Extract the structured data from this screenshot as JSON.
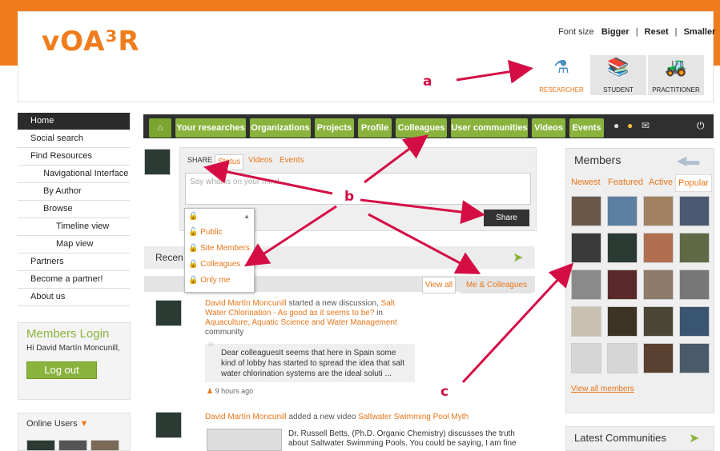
{
  "header": {
    "logo_text": "vOA³R",
    "font_size_label": "Font size",
    "font_bigger": "Bigger",
    "font_reset": "Reset",
    "font_smaller": "Smaller",
    "roles": [
      "RESEARCHER",
      "STUDENT",
      "PRACTITIONER"
    ]
  },
  "leftnav": {
    "items": [
      "Home",
      "Social search",
      "Find Resources",
      "Navigational Interface",
      "By Author",
      "Browse",
      "Timeline view",
      "Map view",
      "Partners",
      "Become a partner!",
      "About us"
    ]
  },
  "login": {
    "title": "Members Login",
    "greeting": "Hi David Martín Moncunill,",
    "logout": "Log out"
  },
  "online_users": {
    "label": "Online Users"
  },
  "tabs": [
    "Your researches",
    "Organizations",
    "Projects",
    "Profile",
    "Colleagues",
    "User communities",
    "Videos",
    "Events"
  ],
  "share": {
    "label": "SHARE",
    "tabs": [
      "Status",
      "Videos",
      "Events"
    ],
    "placeholder": "Say what is on your mind...",
    "button": "Share",
    "privacy_options": [
      "Public",
      "Site Members",
      "Colleagues",
      "Only me"
    ]
  },
  "recent": {
    "title_partial": "Recen",
    "view_all": "View all",
    "me_colleagues": "Me & Colleagues"
  },
  "activity": [
    {
      "author": "David Martín Moncunill",
      "text1": " started a new discussion, ",
      "link": "Salt Water Chlorination - As good as it seems to be?",
      "text2": " in ",
      "community": "Aquaculture, Aquatic Science and Water Management",
      "text3": " community",
      "quote": "Dear colleaguesIt seems that here in Spain some kind of lobby has started to spread the idea that salt water chlorination systems are the ideal soluti ...",
      "time": "9 hours ago"
    },
    {
      "author": "David Martín Moncunill",
      "text1": " added a new video ",
      "link": "Saltwater Swimming Pool Myth",
      "snippet": "Dr. Russell Betts, (Ph.D. Organic Chemistry) discusses the truth about Saltwater Swimming Pools. You could be saying, I am fine"
    }
  ],
  "members": {
    "title": "Members",
    "tabs": [
      "Newest",
      "Featured",
      "Active",
      "Popular"
    ],
    "view_all": "View all members",
    "thumb_labels": [
      "",
      "",
      "",
      "",
      "",
      "",
      "",
      "",
      "",
      "",
      "",
      "",
      "",
      "",
      "",
      "",
      "",
      "",
      "",
      ""
    ]
  },
  "latest": {
    "title": "Latest Communities"
  },
  "annotations": {
    "a": "a",
    "b": "b",
    "c": "c"
  },
  "colors": {
    "orange": "#f07d1d",
    "green": "#8ab33d",
    "dark": "#2f2f2f",
    "annotation": "#d40e45"
  }
}
